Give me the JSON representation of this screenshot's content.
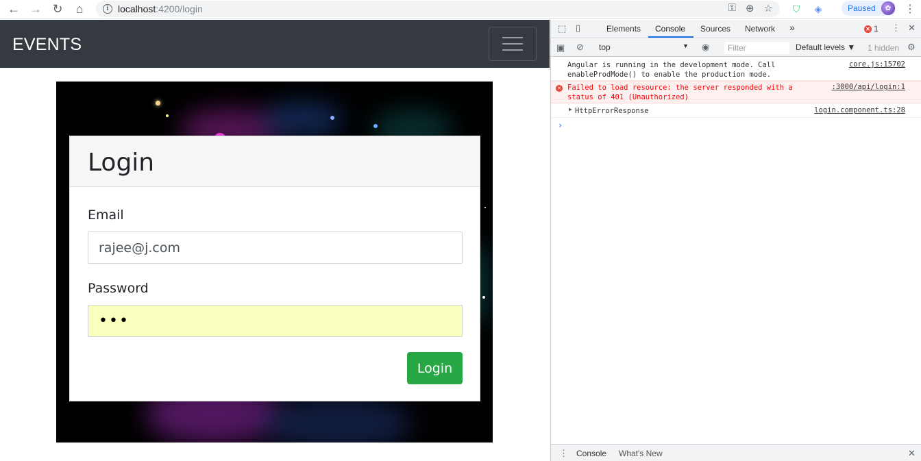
{
  "browser": {
    "url_host": "localhost",
    "url_rest": ":4200/login",
    "paused_label": "Paused"
  },
  "app": {
    "brand": "EVENTS",
    "login": {
      "title": "Login",
      "email_label": "Email",
      "email_value": "rajee@j.com",
      "password_label": "Password",
      "password_value": "•••",
      "submit_label": "Login"
    },
    "colors": {
      "navbar": "#343a40",
      "button": "#28a745",
      "autofill": "#faffbd"
    }
  },
  "devtools": {
    "tabs": [
      "Elements",
      "Console",
      "Sources",
      "Network"
    ],
    "active_tab": "Console",
    "more_tabs": "»",
    "error_count": "1",
    "context": "top",
    "filter_placeholder": "Filter",
    "levels": "Default levels ▼",
    "hidden": "1 hidden",
    "messages": [
      {
        "text": "Angular is running in the development mode. Call\nenableProdMode() to enable the production mode.",
        "source": "core.js:15702",
        "level": "info"
      },
      {
        "text": "Failed to load resource: the server responded with a\nstatus of 401 (Unauthorized)",
        "source": ":3000/api/login:1",
        "level": "error"
      },
      {
        "text": "HttpErrorResponse",
        "source": "login.component.ts:28",
        "level": "object"
      }
    ],
    "prompt": "›",
    "drawer_tabs": [
      "Console",
      "What's New"
    ]
  }
}
